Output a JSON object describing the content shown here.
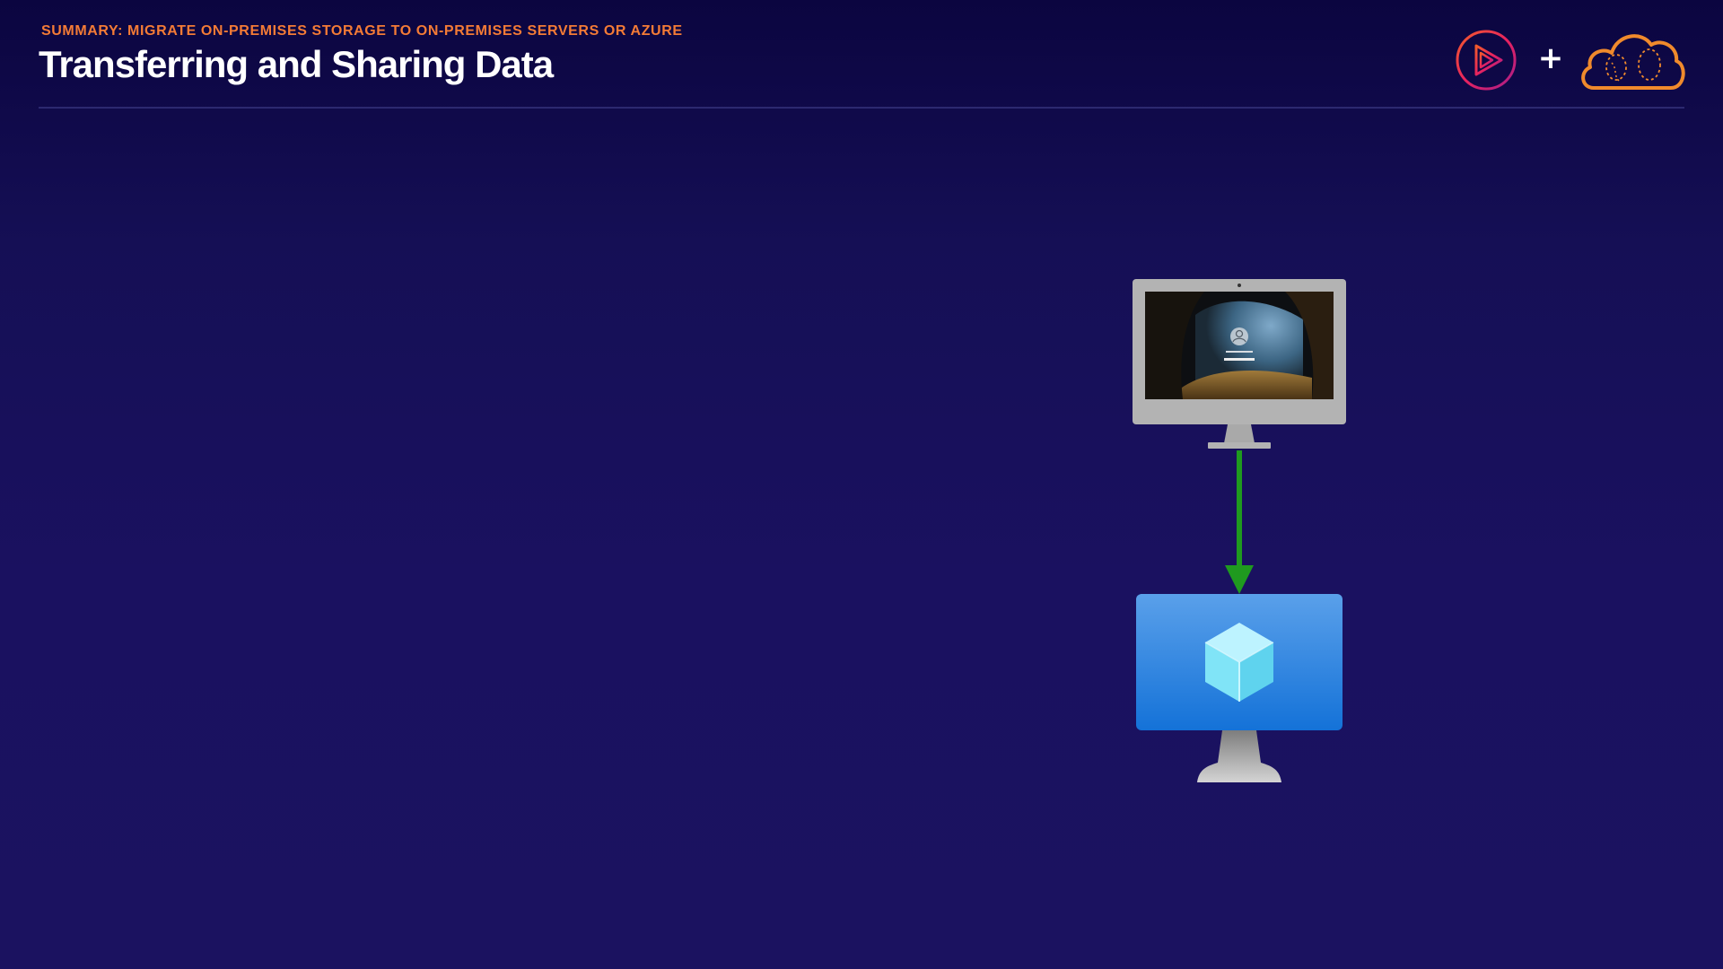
{
  "header": {
    "subtitle": "SUMMARY: MIGRATE ON-PREMISES STORAGE TO ON-PREMISES SERVERS OR AZURE",
    "title": "Transferring and Sharing Data"
  },
  "logos": {
    "brand_icon": "pluralsight-play-icon",
    "plus_sign": "+",
    "partner_icon": "cloud-logo-icon"
  },
  "diagram": {
    "source_icon": "desktop-monitor-icon",
    "connector_icon": "down-arrow-icon",
    "target_icon": "azure-virtual-machine-icon"
  },
  "colors": {
    "accent_orange": "#f47b36",
    "arrow_green": "#1f9a1f",
    "vm_blue": "#1d7fe0",
    "monitor_gray": "#b3b3b3"
  }
}
